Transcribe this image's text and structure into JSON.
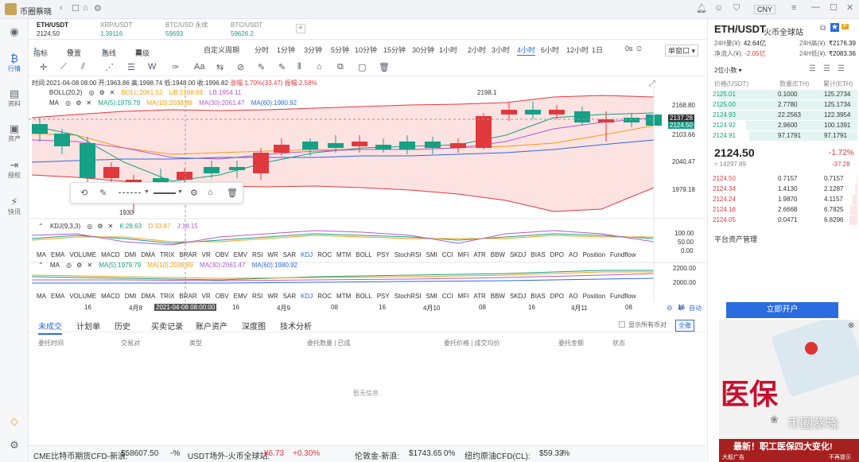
{
  "app": {
    "title": "币圈蔡晓",
    "currency": "CNY"
  },
  "sidebar": [
    {
      "label": "行情",
      "icon": "chart-icon",
      "active": true
    },
    {
      "label": "资料",
      "icon": "doc-icon"
    },
    {
      "label": "资产",
      "icon": "wallet-icon"
    },
    {
      "label": "授权",
      "icon": "key-icon"
    },
    {
      "label": "快讯",
      "icon": "news-icon"
    }
  ],
  "tabs": [
    {
      "pair": "ETH/USDT",
      "price": "2124.50"
    },
    {
      "pair": "XRP/USDT",
      "price": "1.39116"
    },
    {
      "pair": "BTC/USD 永续",
      "price": "59693"
    },
    {
      "pair": "BTC/USDT",
      "price": "59626.2"
    }
  ],
  "toolbar": {
    "items": [
      "指标",
      "设置",
      "画线",
      "高级",
      "自定义周期",
      "分时",
      "1分钟",
      "3分钟",
      "5分钟",
      "10分钟",
      "15分钟",
      "30分钟",
      "1小时",
      "2小时",
      "3小时",
      "4小时",
      "6小时",
      "12小时",
      "1日"
    ],
    "active": "4小时",
    "interval": "0s",
    "window": "单窗口"
  },
  "info": {
    "time": "时间:2021-04-08 08:00",
    "open": "开:1963.86",
    "high": "高:1998.74",
    "low": "低:1948.00",
    "close": "收:1996.82",
    "change": "涨幅:1.70%(33.47)",
    "amp": "振幅:2.58%"
  },
  "boll": {
    "name": "BOLL(20,2)",
    "boll": "BOLL:2061.52",
    "ub": "UB:2168.93",
    "lb": "LB:1954.11"
  },
  "ma": {
    "name": "MA",
    "ma5": "MA(5):1979.79",
    "ma10": "MA(10):2038.89",
    "ma30": "MA(30):2061.47",
    "ma60": "MA(60):1980.92"
  },
  "kdj": {
    "name": "KDJ(9,3,3)",
    "k": "K:28.63",
    "d": "D:33.87",
    "j": "J:18.15"
  },
  "indicators": [
    "MA",
    "EMA",
    "VOLUME",
    "MACD",
    "DMI",
    "DMA",
    "TRIX",
    "BRAR",
    "VR",
    "OBV",
    "EMV",
    "RSI",
    "WR",
    "SAR",
    "KDJ",
    "ROC",
    "MTM",
    "BOLL",
    "PSY",
    "StochRSI",
    "SMI",
    "CCI",
    "MFI",
    "ATR",
    "BBW",
    "SKDJ",
    "BIAS",
    "DPO",
    "AO",
    "Position",
    "Fundflow"
  ],
  "indicator_active": "KDJ",
  "price_axis": [
    "2168.80",
    "2137.28",
    "2124.50",
    "2103.66",
    "2040.47",
    "1979.18"
  ],
  "kdj_axis": [
    "100.00",
    "50.00",
    "0.00"
  ],
  "ma_axis": [
    "2200.00",
    "2000.00"
  ],
  "markers": {
    "high": "2198.1",
    "low": "1930"
  },
  "time_axis": [
    "16",
    "4月8",
    "2021-04-08 08:00:00",
    "16",
    "4月9",
    "08",
    "16",
    "4月10",
    "08",
    "16",
    "4月11",
    "08",
    "16"
  ],
  "chart_controls": {
    "auto": "自动"
  },
  "bottom_tabs": [
    "未成交",
    "计划单",
    "历史",
    "买卖记录",
    "账户资产",
    "深度图",
    "技术分析"
  ],
  "bottom_active": "未成交",
  "show_all": "显示所有币对",
  "cancel_all": "全撤",
  "order_cols": [
    "委托时间",
    "交易对",
    "类型",
    "委托数量 | 已成",
    "委托价格 | 成交均价",
    "委托金额",
    "状态"
  ],
  "empty": "暂无信息",
  "status": [
    "CME比特币期货CFD-新浪:",
    "$58607.50",
    "-%",
    "USDT场外-火币全球站:",
    "¥6.73",
    "+0.30%",
    "伦敦金-新浪:",
    "$1743.65",
    "0%",
    "纽约原油CFD(CL):",
    "$59.33",
    "-%"
  ],
  "right": {
    "pair": "ETH/USDT",
    "exchange": "火币全球站",
    "high_label": "24H高(¥):",
    "high": "₹2176.39",
    "low_label": "24H低(¥):",
    "low": "₹2083.36",
    "vol_label": "24H量(¥):",
    "vol": "42.64亿",
    "net_label": "净流入(¥):",
    "net": "-2.05亿",
    "decimals": "2位小数",
    "cols": [
      "价格(USDT)",
      "数量(ETH)",
      "累计(ETH)"
    ],
    "asks": [
      [
        "2125.01",
        "0.1000",
        "125.2734"
      ],
      [
        "2125.00",
        "2.7780",
        "125.1734"
      ],
      [
        "2124.93",
        "22.2563",
        "122.3954"
      ],
      [
        "2124.92",
        "2.9600",
        "100.1391"
      ],
      [
        "2124.91",
        "97.1791",
        "97.1791"
      ]
    ],
    "last": "2124.50",
    "last_cny": "≈ 14297.89",
    "pct": "-1.72%",
    "chg": "-37.28",
    "bids": [
      [
        "2124.50",
        "0.7157",
        "0.7157"
      ],
      [
        "2124.34",
        "1.4130",
        "2.1287"
      ],
      [
        "2124.24",
        "1.9870",
        "4.1157"
      ],
      [
        "2124.18",
        "2.6668",
        "6.7825"
      ],
      [
        "2124.05",
        "0.0471",
        "6.8296"
      ]
    ],
    "asset": "平台资产管理",
    "open_account": "立即开户"
  },
  "ad": {
    "title": "医保",
    "wechat": "币圈蔡晓",
    "banner": "最新！职工医保四大变化!",
    "left": "大般广告",
    "right": "不再提示"
  },
  "colors": {
    "up": "#e0393e",
    "down": "#16a085",
    "accent": "#2a6be0",
    "boll_fill": "#fde2e2"
  }
}
